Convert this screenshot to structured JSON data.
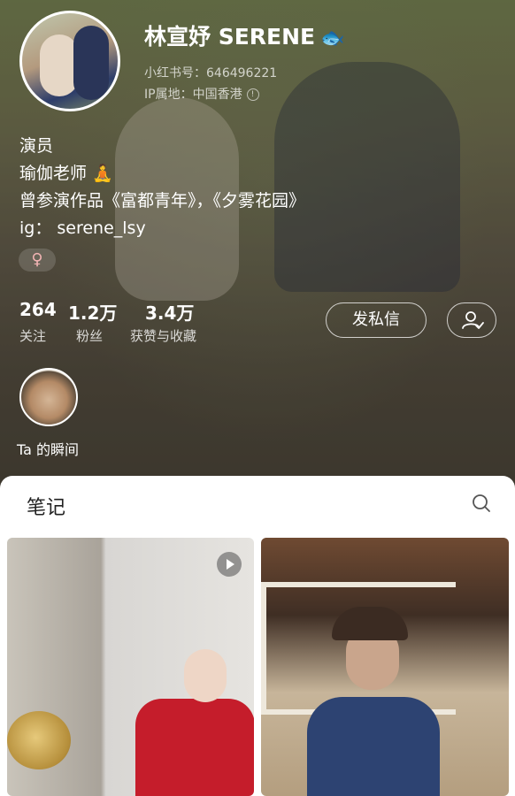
{
  "profile": {
    "name": "林宣妤 SERENE",
    "name_icon": "fish-emoji",
    "xhs_id": "小红书号：646496221",
    "ip_location": "IP属地：中国香港",
    "bio": [
      "演员",
      "瑜伽老师 🧘",
      "曾参演作品《富都青年》，《夕雾花园》",
      "ig： serene_lsy"
    ],
    "gender_symbol": "♀",
    "gender_color": "#f2b4b4"
  },
  "stats": [
    {
      "value": "264",
      "label": "关注"
    },
    {
      "value": "1.2万",
      "label": "粉丝"
    },
    {
      "value": "3.4万",
      "label": "获赞与收藏"
    }
  ],
  "actions": {
    "message_label": "发私信",
    "follow_icon": "user-check-icon"
  },
  "moments": {
    "label": "Ta 的瞬间"
  },
  "notes": {
    "tab_title": "笔记",
    "search_icon": "search-icon",
    "cards": [
      {
        "type": "video"
      },
      {
        "type": "image"
      }
    ]
  }
}
